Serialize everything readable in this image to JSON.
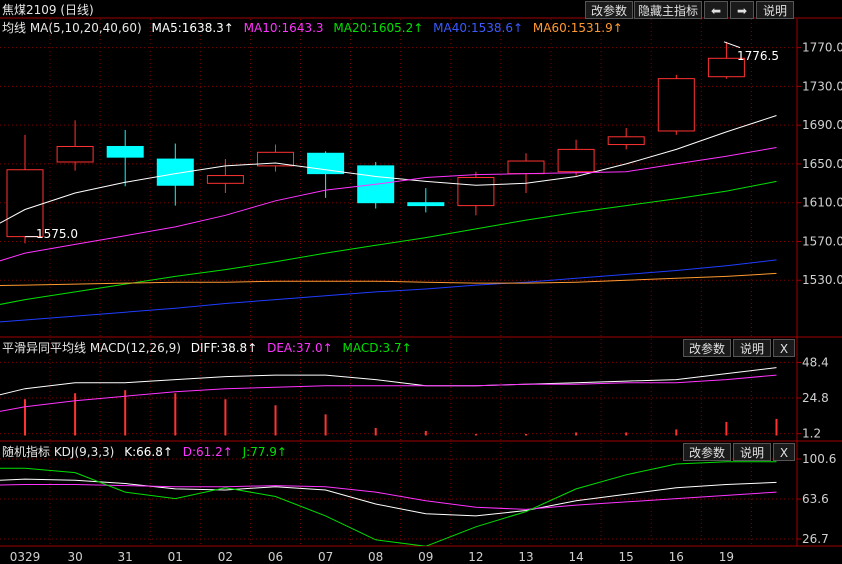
{
  "title": "焦煤2109 (日线)",
  "buttons": {
    "change_params": "改参数",
    "hide_main": "隐藏主指标",
    "prev": "⬅",
    "next": "➡",
    "help": "说明",
    "close": "X"
  },
  "colors": {
    "up": "#ff3232",
    "down": "#00ffff",
    "ma5": "#ffffff",
    "ma10": "#ff33ff",
    "ma20": "#00e000",
    "ma40": "#1f3dff",
    "ma60": "#ff9a30",
    "grid": "#7a0000",
    "axis": "#a00000"
  },
  "main_header": {
    "label": "均线 MA(5,10,20,40,60)",
    "ma5": "MA5:1638.3↑",
    "ma10": "MA10:1643.3",
    "ma20": "MA20:1605.2↑",
    "ma40": "MA40:1538.6↑",
    "ma60": "MA60:1531.9↑"
  },
  "macd_header": {
    "label": "平滑异同平均线 MACD(12,26,9)",
    "diff": "DIFF:38.8↑",
    "dea": "DEA:37.0↑",
    "macd": "MACD:3.7↑"
  },
  "kdj_header": {
    "label": "随机指标 KDJ(9,3,3)",
    "k": "K:66.8↑",
    "d": "D:61.2↑",
    "j": "J:77.9↑"
  },
  "annotations": {
    "low": "1575.0",
    "high": "1776.5"
  },
  "chart_data": [
    {
      "type": "candlestick",
      "title": "焦煤2109 (日线)",
      "categories": [
        "0329",
        "30",
        "31",
        "01",
        "02",
        "06",
        "07",
        "08",
        "09",
        "12",
        "13",
        "14",
        "15",
        "16",
        "19"
      ],
      "yticks": [
        1770.0,
        1730.0,
        1690.0,
        1650.0,
        1610.0,
        1570.0,
        1530.0
      ],
      "ylim": [
        1490,
        1782
      ],
      "candles": [
        {
          "o": 1575,
          "h": 1680,
          "l": 1568,
          "c": 1644
        },
        {
          "o": 1652,
          "h": 1695,
          "l": 1643,
          "c": 1668
        },
        {
          "o": 1668,
          "h": 1685,
          "l": 1627,
          "c": 1657
        },
        {
          "o": 1655,
          "h": 1671,
          "l": 1607,
          "c": 1628
        },
        {
          "o": 1630,
          "h": 1655,
          "l": 1620,
          "c": 1638
        },
        {
          "o": 1648,
          "h": 1670,
          "l": 1642,
          "c": 1662
        },
        {
          "o": 1661,
          "h": 1663,
          "l": 1615,
          "c": 1640
        },
        {
          "o": 1648,
          "h": 1652,
          "l": 1604,
          "c": 1610
        },
        {
          "o": 1610,
          "h": 1625,
          "l": 1600,
          "c": 1607
        },
        {
          "o": 1607,
          "h": 1642,
          "l": 1597,
          "c": 1636
        },
        {
          "o": 1640,
          "h": 1661,
          "l": 1620,
          "c": 1653
        },
        {
          "o": 1642,
          "h": 1675,
          "l": 1638,
          "c": 1665
        },
        {
          "o": 1670,
          "h": 1687,
          "l": 1665,
          "c": 1678
        },
        {
          "o": 1684,
          "h": 1742,
          "l": 1680,
          "c": 1738
        },
        {
          "o": 1740,
          "h": 1776,
          "l": 1738,
          "c": 1759
        }
      ],
      "series": [
        {
          "name": "MA5",
          "values": [
            1575,
            1603,
            1620,
            1631,
            1640,
            1648,
            1651,
            1644,
            1637,
            1632,
            1628,
            1630,
            1637,
            1650,
            1665,
            1683,
            1700
          ]
        },
        {
          "name": "MA10",
          "values": [
            1542,
            1558,
            1567,
            1576,
            1585,
            1597,
            1612,
            1623,
            1629,
            1636,
            1639,
            1640,
            1641,
            1642,
            1650,
            1658,
            1667
          ]
        },
        {
          "name": "MA20",
          "values": [
            1500,
            1510,
            1518,
            1526,
            1534,
            1541,
            1549,
            1558,
            1566,
            1574,
            1583,
            1592,
            1600,
            1607,
            1614,
            1622,
            1632
          ]
        },
        {
          "name": "MA40",
          "values": [
            1485,
            1489,
            1493,
            1497,
            1501,
            1506,
            1510,
            1514,
            1518,
            1521,
            1525,
            1528,
            1532,
            1536,
            1540,
            1545,
            1551
          ]
        },
        {
          "name": "MA60",
          "values": [
            1524,
            1525,
            1526,
            1527,
            1528,
            1528,
            1529,
            1529,
            1529,
            1528,
            1527,
            1527,
            1528,
            1530,
            1532,
            1534,
            1537
          ]
        }
      ]
    },
    {
      "type": "line+bar",
      "title": "MACD(12,26,9)",
      "yticks": [
        48.4,
        24.8,
        1.2
      ],
      "ylim": [
        -3,
        52
      ],
      "series": [
        {
          "name": "DIFF",
          "values": [
            23,
            31,
            35,
            35,
            37,
            39,
            40,
            40,
            37,
            33,
            33,
            34,
            35,
            36,
            37,
            41,
            45
          ]
        },
        {
          "name": "DEA",
          "values": [
            13,
            19,
            23,
            26,
            29,
            31,
            32,
            33,
            33,
            33,
            33,
            34,
            34,
            35,
            35,
            37,
            40
          ]
        },
        {
          "name": "MACD",
          "values": [
            null,
            24,
            28,
            30,
            28,
            24,
            20,
            14,
            5,
            3,
            1,
            1,
            2,
            2,
            4,
            9,
            11
          ]
        }
      ]
    },
    {
      "type": "line",
      "title": "KDJ(9,3,3)",
      "yticks": [
        100.6,
        63.6,
        26.7
      ],
      "ylim": [
        26.7,
        100.6
      ],
      "series": [
        {
          "name": "K",
          "values": [
            80,
            82,
            81,
            78,
            73,
            72,
            75,
            72,
            59,
            50,
            48,
            53,
            62,
            68,
            74,
            77,
            79
          ]
        },
        {
          "name": "D",
          "values": [
            76,
            77,
            77,
            76,
            75,
            75,
            76,
            75,
            70,
            62,
            56,
            54,
            58,
            61,
            64,
            67,
            70
          ]
        },
        {
          "name": "J",
          "values": [
            92,
            92,
            88,
            70,
            64,
            74,
            66,
            48,
            26,
            20,
            38,
            52,
            73,
            86,
            96,
            98,
            98
          ]
        }
      ]
    }
  ]
}
